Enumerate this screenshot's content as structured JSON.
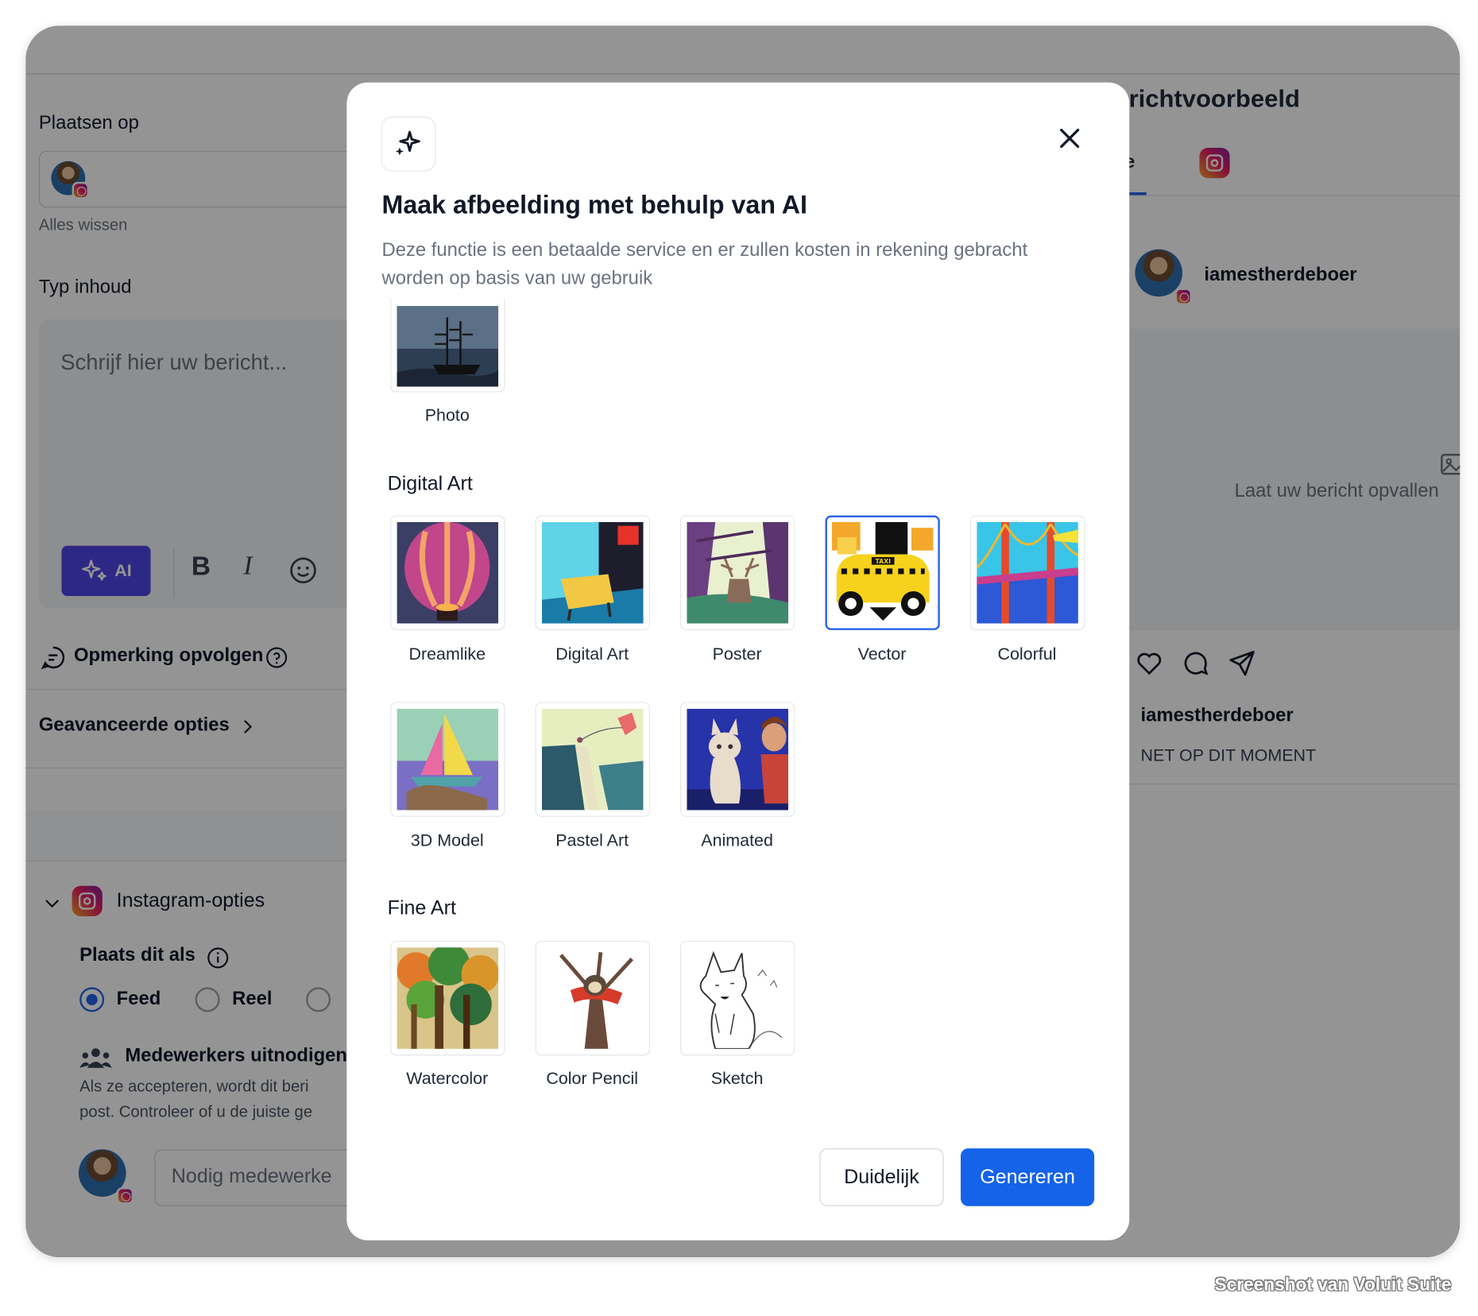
{
  "composer": {
    "post_to_label": "Plaatsen op",
    "clear_all": "Alles wissen",
    "content_label": "Typ inhoud",
    "editor_placeholder": "Schrijf hier uw bericht...",
    "ai_label": "AI",
    "follow_up_label": "Opmerking opvolgen",
    "advanced_label": "Geavanceerde opties",
    "instagram_options": "Instagram-opties",
    "post_as_label": "Plaats dit als",
    "post_as_options": [
      "Feed",
      "Reel"
    ],
    "post_as_selected": "Feed",
    "collaborators_title": "Medewerkers uitnodigen",
    "collaborators_desc_1": "Als ze accepteren, wordt dit beri",
    "collaborators_desc_2": "post. Controleer of u de juiste ge",
    "collaborators_placeholder": "Nodig medewerke"
  },
  "preview": {
    "title": "erichtvoorbeeld",
    "tab_partial": "le",
    "username": "iamestherdeboer",
    "empty_text": "Laat uw bericht opvallen",
    "caption_user": "iamestherdeboer",
    "timestamp": "NET OP DIT MOMENT"
  },
  "modal": {
    "title": "Maak afbeelding met behulp van AI",
    "description": "Deze functie is een betaalde service en er zullen kosten in rekening gebracht worden op basis van uw gebruik",
    "top_styles": [
      {
        "label": "Photo"
      }
    ],
    "sections": [
      {
        "name": "Digital Art",
        "styles": [
          {
            "label": "Dreamlike"
          },
          {
            "label": "Digital Art"
          },
          {
            "label": "Poster"
          },
          {
            "label": "Vector"
          },
          {
            "label": "Colorful"
          },
          {
            "label": "3D Model"
          },
          {
            "label": "Pastel Art"
          },
          {
            "label": "Animated"
          }
        ]
      },
      {
        "name": "Fine Art",
        "styles": [
          {
            "label": "Watercolor"
          },
          {
            "label": "Color Pencil"
          },
          {
            "label": "Sketch"
          }
        ]
      }
    ],
    "selected_style": "Vector",
    "vector_sign_text": "TAXI",
    "clear_button": "Duidelijk",
    "generate_button": "Genereren"
  },
  "watermark": "Screenshot van Voluit Suite",
  "colors": {
    "accent": "#1463e8",
    "ai_button": "#4f46e5",
    "selected_border": "#2563eb"
  }
}
